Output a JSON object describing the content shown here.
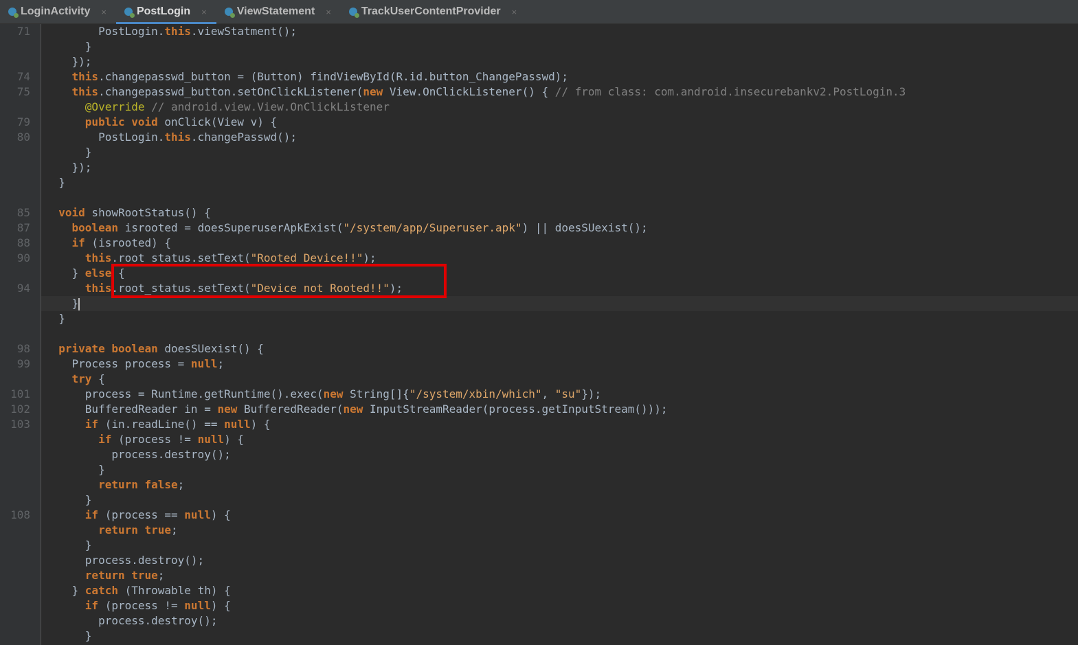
{
  "tabs": [
    {
      "label": "LoginActivity",
      "active": false
    },
    {
      "label": "PostLogin",
      "active": true
    },
    {
      "label": "ViewStatement",
      "active": false
    },
    {
      "label": "TrackUserContentProvider",
      "active": false
    }
  ],
  "tab_icon": "java-class-icon",
  "close_icon": "×",
  "lines": [
    {
      "num": "71",
      "text": "        PostLogin.this.viewStatment();"
    },
    {
      "num": "",
      "text": "      }"
    },
    {
      "num": "",
      "text": "    });"
    },
    {
      "num": "74",
      "text": "    this.changepasswd_button = (Button) findViewById(R.id.button_ChangePasswd);"
    },
    {
      "num": "75",
      "text": "    this.changepasswd_button.setOnClickListener(new View.OnClickListener() { // from class: com.android.insecurebankv2.PostLogin.3"
    },
    {
      "num": "",
      "text": "      @Override // android.view.View.OnClickListener"
    },
    {
      "num": "79",
      "text": "      public void onClick(View v) {"
    },
    {
      "num": "80",
      "text": "        PostLogin.this.changePasswd();"
    },
    {
      "num": "",
      "text": "      }"
    },
    {
      "num": "",
      "text": "    });"
    },
    {
      "num": "",
      "text": "  }"
    },
    {
      "num": "",
      "text": ""
    },
    {
      "num": "85",
      "text": "  void showRootStatus() {"
    },
    {
      "num": "87",
      "text": "    boolean isrooted = doesSuperuserApkExist(\"/system/app/Superuser.apk\") || doesSUexist();"
    },
    {
      "num": "88",
      "text": "    if (isrooted) {"
    },
    {
      "num": "90",
      "text": "      this.root_status.setText(\"Rooted Device!!\");"
    },
    {
      "num": "",
      "text": "    } else {"
    },
    {
      "num": "94",
      "text": "      this.root_status.setText(\"Device not Rooted!!\");"
    },
    {
      "num": "",
      "text": "    }"
    },
    {
      "num": "",
      "text": "  }"
    },
    {
      "num": "",
      "text": ""
    },
    {
      "num": "98",
      "text": "  private boolean doesSUexist() {"
    },
    {
      "num": "99",
      "text": "    Process process = null;"
    },
    {
      "num": "",
      "text": "    try {"
    },
    {
      "num": "101",
      "text": "      process = Runtime.getRuntime().exec(new String[]{\"/system/xbin/which\", \"su\"});"
    },
    {
      "num": "102",
      "text": "      BufferedReader in = new BufferedReader(new InputStreamReader(process.getInputStream()));"
    },
    {
      "num": "103",
      "text": "      if (in.readLine() == null) {"
    },
    {
      "num": "",
      "text": "        if (process != null) {"
    },
    {
      "num": "",
      "text": "          process.destroy();"
    },
    {
      "num": "",
      "text": "        }"
    },
    {
      "num": "",
      "text": "        return false;"
    },
    {
      "num": "",
      "text": "      }"
    },
    {
      "num": "108",
      "text": "      if (process == null) {"
    },
    {
      "num": "",
      "text": "        return true;"
    },
    {
      "num": "",
      "text": "      }"
    },
    {
      "num": "",
      "text": "      process.destroy();"
    },
    {
      "num": "",
      "text": "      return true;"
    },
    {
      "num": "",
      "text": "    } catch (Throwable th) {"
    },
    {
      "num": "",
      "text": "      if (process != null) {"
    },
    {
      "num": "",
      "text": "        process.destroy();"
    },
    {
      "num": "",
      "text": "      }"
    }
  ],
  "caret_line_index": 18,
  "colors": {
    "background": "#2b2b2b",
    "keyword": "#cc7832",
    "string": "#e0a86a",
    "comment": "#808080",
    "annotation": "#bbb529",
    "highlight_box": "#e00000",
    "active_tab_underline": "#4a88c7"
  }
}
